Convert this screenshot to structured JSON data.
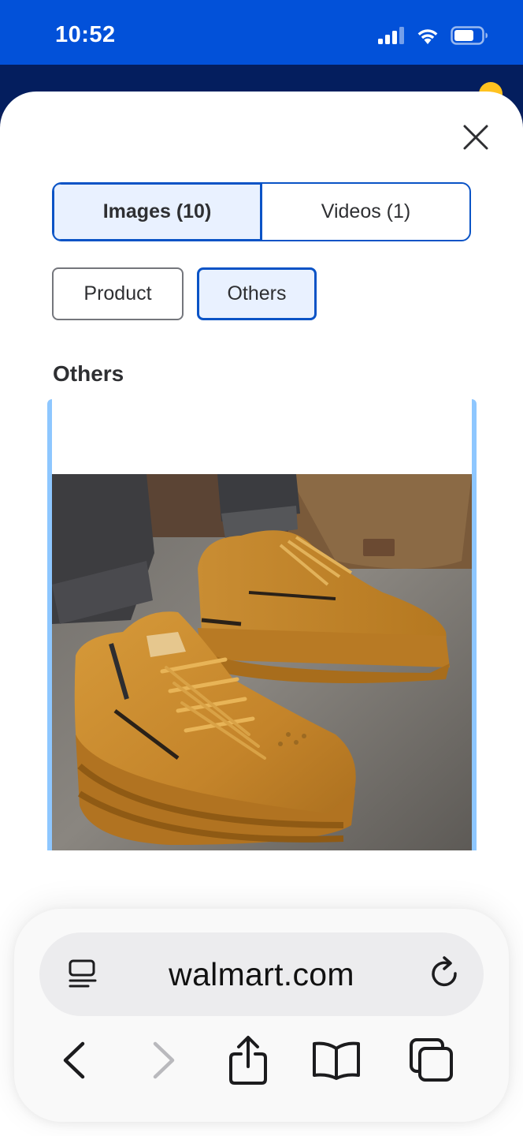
{
  "status_bar": {
    "time": "10:52",
    "icons": [
      "cellular-signal-icon",
      "wifi-icon",
      "battery-icon"
    ]
  },
  "sheet": {
    "close_icon": "close-icon",
    "media_tabs": [
      {
        "label": "Images (10)",
        "selected": true
      },
      {
        "label": "Videos (1)",
        "selected": false
      }
    ],
    "filter_chips": [
      {
        "label": "Product",
        "selected": false
      },
      {
        "label": "Others",
        "selected": true
      }
    ],
    "section_title": "Others",
    "media_item": {
      "type": "image",
      "subject": "tan leather high-top lace-up boots with side zipper on a person walking on stone pavement"
    }
  },
  "browser": {
    "url": "walmart.com",
    "toolbar_icons": [
      "reader-icon",
      "reload-icon",
      "back-icon",
      "forward-icon",
      "share-icon",
      "bookmarks-icon",
      "tabs-icon"
    ],
    "forward_enabled": false
  },
  "colors": {
    "status_bar_bg": "#0251d9",
    "accent_blue": "#0a53c6",
    "selected_fill": "#e9f1ff",
    "card_edge": "#8ec7ff",
    "text": "#2e2f32"
  }
}
